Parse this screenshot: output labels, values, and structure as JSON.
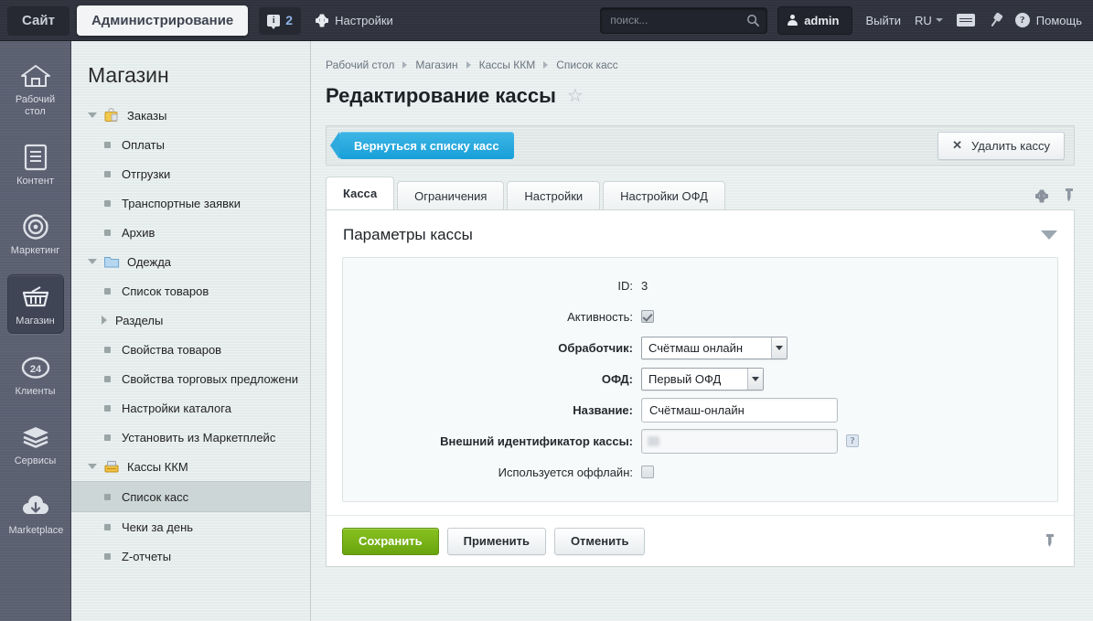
{
  "header": {
    "site_tab": "Сайт",
    "admin_tab": "Администрирование",
    "notifications_count": "2",
    "notifications_icon": "info-bubble-icon",
    "settings_label": "Настройки",
    "settings_icon": "gear-icon",
    "search_placeholder": "поиск...",
    "search_icon": "search-icon",
    "user_name": "admin",
    "user_icon": "person-icon",
    "logout_label": "Выйти",
    "language": "RU",
    "keyboard_icon": "keyboard-icon",
    "pin_icon": "pin-icon",
    "help_label": "Помощь",
    "help_icon": "question-circle-icon"
  },
  "iconbar": [
    {
      "label": "Рабочий стол",
      "icon": "home-icon",
      "active": false
    },
    {
      "label": "Контент",
      "icon": "document-icon",
      "active": false
    },
    {
      "label": "Маркетинг",
      "icon": "target-icon",
      "active": false
    },
    {
      "label": "Магазин",
      "icon": "basket-icon",
      "active": true
    },
    {
      "label": "Клиенты",
      "icon": "clock24-icon",
      "active": false
    },
    {
      "label": "Сервисы",
      "icon": "layers-icon",
      "active": false
    },
    {
      "label": "Marketplace",
      "icon": "cloud-download-icon",
      "active": false
    }
  ],
  "menu": {
    "title": "Магазин",
    "items": [
      {
        "label": "Заказы",
        "type": "group-open",
        "icon": "orders-bag-icon"
      },
      {
        "label": "Оплаты",
        "type": "leaf"
      },
      {
        "label": "Отгрузки",
        "type": "leaf"
      },
      {
        "label": "Транспортные заявки",
        "type": "leaf"
      },
      {
        "label": "Архив",
        "type": "leaf"
      },
      {
        "label": "Одежда",
        "type": "group-open",
        "icon": "folder-icon"
      },
      {
        "label": "Список товаров",
        "type": "leaf"
      },
      {
        "label": "Разделы",
        "type": "group-closed"
      },
      {
        "label": "Свойства товаров",
        "type": "leaf"
      },
      {
        "label": "Свойства торговых предложени",
        "type": "leaf"
      },
      {
        "label": "Настройки каталога",
        "type": "leaf"
      },
      {
        "label": "Установить из Маркетплейс",
        "type": "leaf"
      },
      {
        "label": "Кассы ККМ",
        "type": "group-open",
        "icon": "cashbox-icon"
      },
      {
        "label": "Список касс",
        "type": "leaf",
        "active": true
      },
      {
        "label": "Чеки за день",
        "type": "leaf"
      },
      {
        "label": "Z-отчеты",
        "type": "leaf"
      }
    ]
  },
  "breadcrumb": [
    "Рабочий стол",
    "Магазин",
    "Кассы ККМ",
    "Список касс"
  ],
  "page": {
    "title": "Редактирование кассы",
    "favorite_icon": "star-icon",
    "back_button": "Вернуться к списку касс",
    "delete_button": "Удалить кассу",
    "delete_icon": "close-x-icon",
    "settings_icon": "gear-icon",
    "pin_icon": "pin-icon"
  },
  "tabs": [
    {
      "label": "Касса",
      "active": true
    },
    {
      "label": "Ограничения",
      "active": false
    },
    {
      "label": "Настройки",
      "active": false
    },
    {
      "label": "Настройки ОФД",
      "active": false
    }
  ],
  "form": {
    "section_title": "Параметры кассы",
    "collapse_icon": "chevron-down-icon",
    "fields": {
      "id_label": "ID:",
      "id_value": "3",
      "active_label": "Активность:",
      "active_checked": true,
      "handler_label": "Обработчик:",
      "handler_value": "Счётмаш онлайн",
      "ofd_label": "ОФД:",
      "ofd_value": "Первый ОФД",
      "name_label": "Название:",
      "name_value": "Счётмаш-онлайн",
      "external_id_label": "Внешний идентификатор кассы:",
      "external_id_value": "",
      "external_id_hint_icon": "question-mark-icon",
      "offline_label": "Используется оффлайн:",
      "offline_checked": false
    }
  },
  "footer": {
    "save": "Сохранить",
    "apply": "Применить",
    "cancel": "Отменить",
    "pin_icon": "pin-icon"
  },
  "colors": {
    "header_bg": "#30333d",
    "accent_blue": "#179fd8",
    "accent_green": "#6aa510",
    "sidebar_bg": "#5a6070",
    "menu_bg": "#e4ebeb"
  }
}
